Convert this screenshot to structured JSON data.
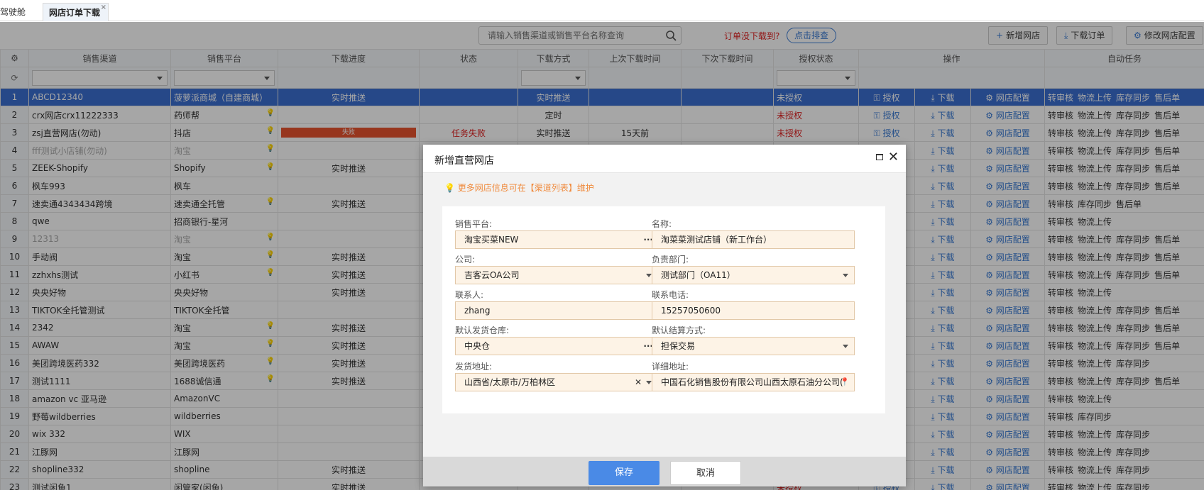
{
  "tabs": [
    {
      "label": "驾驶舱"
    },
    {
      "label": "网店订单下载"
    }
  ],
  "toolbar": {
    "search_placeholder": "请输入销售渠道或销售平台名称查询",
    "not_downloaded": "订单没下载到?",
    "check_label": "点击排查",
    "add_store": "新增网店",
    "download_orders": "下载订单",
    "edit_config": "修改网店配置"
  },
  "columns": [
    "销售渠道",
    "销售平台",
    "下载进度",
    "状态",
    "下载方式",
    "上次下载时间",
    "下次下载时间",
    "授权状态",
    "操作",
    "自动任务"
  ],
  "rows": [
    {
      "no": "1",
      "channel": "ABCD12340",
      "platform": "菠萝派商城（自建商城）",
      "progress": "实时推送",
      "status": "",
      "mode": "实时推送",
      "last": "",
      "auth": "未授权",
      "tasks": [
        "转审核",
        "物流上传",
        "库存同步",
        "售后单"
      ]
    },
    {
      "no": "2",
      "channel": "crx网店crx11222333",
      "platform": "药师帮",
      "progress": "",
      "status": "",
      "mode": "定时",
      "last": "",
      "auth": "未授权",
      "tasks": [
        "转审核",
        "物流上传",
        "库存同步",
        "售后单"
      ]
    },
    {
      "no": "3",
      "channel": "zsj直营网店(勿动)",
      "platform": "抖店",
      "progress": "失败",
      "status": "任务失败",
      "mode": "实时推送",
      "last": "15天前",
      "auth": "未授权",
      "tasks": [
        "转审核",
        "物流上传",
        "库存同步",
        "售后单"
      ]
    },
    {
      "no": "4",
      "channel": "fff测试小店铺(勿动)",
      "platform": "淘宝",
      "progress": "",
      "status": "",
      "mode": "",
      "last": "",
      "auth": "",
      "tasks": [
        "转审核",
        "物流上传",
        "库存同步",
        "售后单"
      ]
    },
    {
      "no": "5",
      "channel": "ZEEK-Shopify",
      "platform": "Shopify",
      "progress": "实时推送",
      "status": "",
      "mode": "",
      "last": "",
      "auth": "",
      "tasks": [
        "转审核",
        "物流上传",
        "库存同步",
        "售后单"
      ]
    },
    {
      "no": "6",
      "channel": "枫车993",
      "platform": "枫车",
      "progress": "",
      "status": "",
      "mode": "",
      "last": "",
      "auth": "",
      "tasks": [
        "转审核",
        "物流上传",
        "库存同步",
        "售后单"
      ]
    },
    {
      "no": "7",
      "channel": "速卖通4343434跨境",
      "platform": "速卖通全托管",
      "progress": "实时推送",
      "status": "",
      "mode": "",
      "last": "",
      "auth": "",
      "tasks": [
        "转审核",
        "库存同步",
        "售后单"
      ]
    },
    {
      "no": "8",
      "channel": "qwe",
      "platform": "招商银行-星河",
      "progress": "",
      "status": "",
      "mode": "",
      "last": "",
      "auth": "",
      "tasks": [
        "转审核",
        "物流上传"
      ]
    },
    {
      "no": "9",
      "channel": "12313",
      "platform": "淘宝",
      "progress": "",
      "status": "",
      "mode": "",
      "last": "",
      "auth": "",
      "tasks": [
        "转审核",
        "物流上传",
        "库存同步",
        "售后单"
      ]
    },
    {
      "no": "10",
      "channel": "手动阀",
      "platform": "淘宝",
      "progress": "实时推送",
      "status": "",
      "mode": "",
      "last": "",
      "auth": "",
      "tasks": [
        "转审核",
        "物流上传",
        "库存同步",
        "售后单"
      ]
    },
    {
      "no": "11",
      "channel": "zzhxhs测试",
      "platform": "小红书",
      "progress": "实时推送",
      "status": "",
      "mode": "",
      "last": "",
      "auth": "",
      "tasks": [
        "转审核",
        "物流上传",
        "库存同步",
        "售后单"
      ]
    },
    {
      "no": "12",
      "channel": "央央好物",
      "platform": "央央好物",
      "progress": "实时推送",
      "status": "",
      "mode": "",
      "last": "",
      "auth": "",
      "tasks": [
        "转审核",
        "物流上传"
      ]
    },
    {
      "no": "13",
      "channel": "TIKTOK全托管测试",
      "platform": "TIKTOK全托管",
      "progress": "",
      "status": "",
      "mode": "",
      "last": "",
      "auth": "",
      "tasks": [
        "转审核",
        "物流上传",
        "库存同步",
        "售后单"
      ]
    },
    {
      "no": "14",
      "channel": "2342",
      "platform": "淘宝",
      "progress": "实时推送",
      "status": "",
      "mode": "",
      "last": "",
      "auth": "",
      "tasks": [
        "转审核",
        "物流上传",
        "库存同步",
        "售后单"
      ]
    },
    {
      "no": "15",
      "channel": "AWAW",
      "platform": "淘宝",
      "progress": "实时推送",
      "status": "",
      "mode": "",
      "last": "",
      "auth": "",
      "tasks": [
        "转审核",
        "物流上传",
        "库存同步",
        "售后单"
      ]
    },
    {
      "no": "16",
      "channel": "美团跨境医药332",
      "platform": "美团跨境医药",
      "progress": "实时推送",
      "status": "",
      "mode": "",
      "last": "",
      "auth": "",
      "tasks": [
        "转审核",
        "物流上传",
        "库存同步"
      ]
    },
    {
      "no": "17",
      "channel": "测试1111",
      "platform": "1688诚信通",
      "progress": "实时推送",
      "status": "",
      "mode": "",
      "last": "",
      "auth": "",
      "tasks": [
        "转审核",
        "物流上传",
        "库存同步",
        "售后单"
      ]
    },
    {
      "no": "18",
      "channel": "amazon vc 亚马逊",
      "platform": "AmazonVC",
      "progress": "",
      "status": "",
      "mode": "",
      "last": "",
      "auth": "",
      "tasks": [
        "转审核",
        "物流上传"
      ]
    },
    {
      "no": "19",
      "channel": "野莓wildberries",
      "platform": "wildberries",
      "progress": "",
      "status": "",
      "mode": "",
      "last": "",
      "auth": "",
      "tasks": [
        "转审核",
        "库存同步"
      ]
    },
    {
      "no": "20",
      "channel": "wix 332",
      "platform": "WIX",
      "progress": "",
      "status": "",
      "mode": "",
      "last": "",
      "auth": "",
      "tasks": [
        "转审核",
        "物流上传",
        "库存同步"
      ]
    },
    {
      "no": "21",
      "channel": "江豚网",
      "platform": "江豚网",
      "progress": "",
      "status": "",
      "mode": "",
      "last": "",
      "auth": "",
      "tasks": [
        "转审核",
        "物流上传",
        "库存同步"
      ]
    },
    {
      "no": "22",
      "channel": "shopline332",
      "platform": "shopline",
      "progress": "实时推送",
      "status": "",
      "mode": "",
      "last": "",
      "auth": "",
      "tasks": [
        "转审核",
        "物流上传",
        "库存同步"
      ]
    },
    {
      "no": "23",
      "channel": "测试闲鱼1",
      "platform": "闲管家(闲鱼)",
      "progress": "实时推送",
      "status": "",
      "mode": "",
      "last": "",
      "auth": "未授权",
      "tasks": [
        "转审核",
        "物流上传",
        "库存同步"
      ]
    }
  ],
  "ops": {
    "auth": "授权",
    "download": "下载",
    "config": "网店配置"
  },
  "modal": {
    "title": "新增直营网店",
    "tip": "更多网店信息可在【渠道列表】维护",
    "fields": {
      "platform_label": "销售平台:",
      "platform_value": "淘宝买菜NEW",
      "name_label": "名称:",
      "name_value": "淘菜菜测试店铺（新工作台）",
      "company_label": "公司:",
      "company_value": "吉客云OA公司",
      "dept_label": "负责部门:",
      "dept_value": "测试部门（OA11）",
      "contact_label": "联系人:",
      "contact_value": "zhang",
      "phone_label": "联系电话:",
      "phone_value": "15257050600",
      "warehouse_label": "默认发货仓库:",
      "warehouse_value": "中央仓",
      "settle_label": "默认结算方式:",
      "settle_value": "担保交易",
      "addr_label": "发货地址:",
      "addr_value": "山西省/太原市/万柏林区",
      "detail_label": "详细地址:",
      "detail_value": "中国石化销售股份有限公司山西太原石油分公司("
    },
    "save": "保存",
    "cancel": "取消"
  }
}
